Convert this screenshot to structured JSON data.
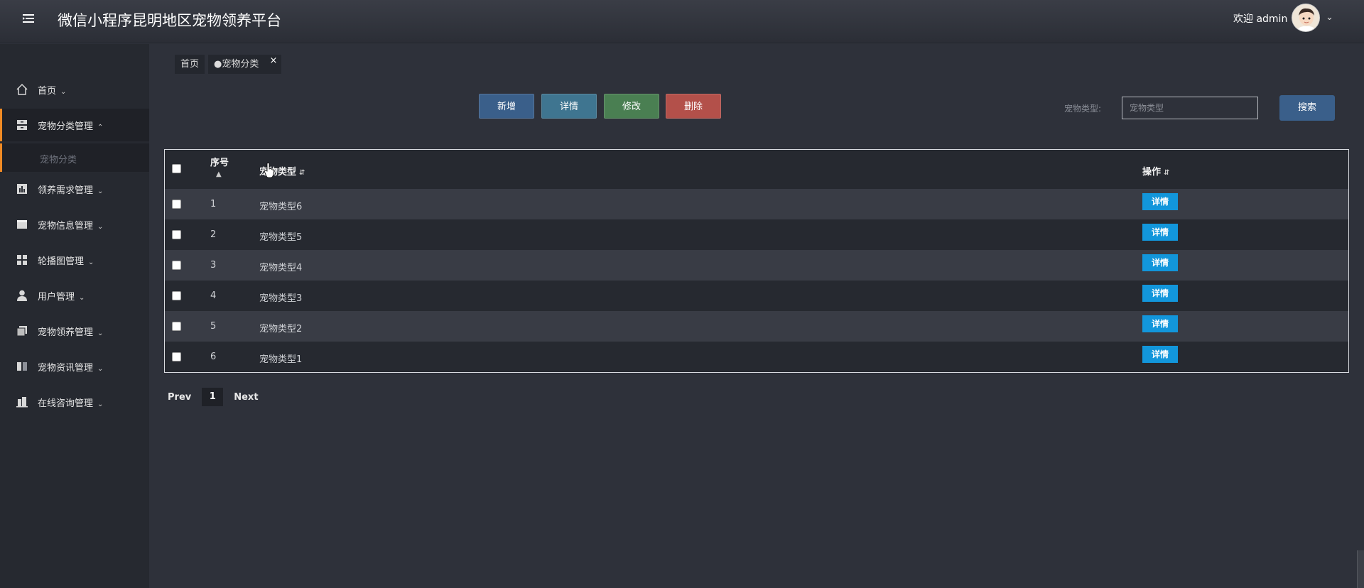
{
  "header": {
    "title": "微信小程序昆明地区宠物领养平台",
    "welcome": "欢迎 admin"
  },
  "sidebar": {
    "items": [
      {
        "label": "首页",
        "icon": "home-icon"
      },
      {
        "label": "宠物分类管理",
        "icon": "archive-icon",
        "expanded": true
      },
      {
        "label": "领养需求管理",
        "icon": "bar-chart-icon"
      },
      {
        "label": "宠物信息管理",
        "icon": "file-icon"
      },
      {
        "label": "轮播图管理",
        "icon": "grid-icon"
      },
      {
        "label": "用户管理",
        "icon": "user-icon"
      },
      {
        "label": "宠物领养管理",
        "icon": "copy-icon"
      },
      {
        "label": "宠物资讯管理",
        "icon": "columns-icon"
      },
      {
        "label": "在线咨询管理",
        "icon": "building-icon"
      }
    ],
    "subitem": "宠物分类"
  },
  "tabs": [
    {
      "label": "首页"
    },
    {
      "label": "●宠物分类",
      "close": "×"
    }
  ],
  "toolbar": {
    "add": "新增",
    "detail": "详情",
    "edit": "修改",
    "delete": "删除"
  },
  "search": {
    "label": "宠物类型:",
    "placeholder": "宠物类型",
    "button": "搜索"
  },
  "table": {
    "columns": [
      "序号",
      "宠物类型",
      "操作"
    ],
    "rows": [
      {
        "index": "1",
        "type": "宠物类型6",
        "action": "详情"
      },
      {
        "index": "2",
        "type": "宠物类型5",
        "action": "详情"
      },
      {
        "index": "3",
        "type": "宠物类型4",
        "action": "详情"
      },
      {
        "index": "4",
        "type": "宠物类型3",
        "action": "详情"
      },
      {
        "index": "5",
        "type": "宠物类型2",
        "action": "详情"
      },
      {
        "index": "6",
        "type": "宠物类型1",
        "action": "详情"
      }
    ]
  },
  "pager": {
    "prev": "Prev",
    "page": "1",
    "next": "Next"
  },
  "colors": {
    "accent": "#f08a24",
    "detail_button": "#1296db"
  }
}
